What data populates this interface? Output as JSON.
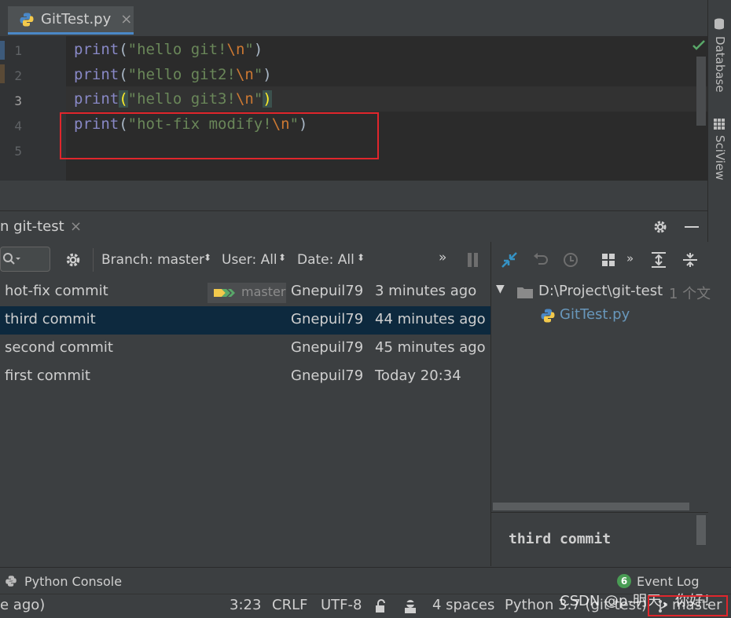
{
  "editor": {
    "tab_label": "GitTest.py",
    "close_glyph": "×",
    "line_numbers": [
      "1",
      "2",
      "3",
      "4",
      "5"
    ],
    "lines": [
      {
        "fn": "print",
        "open": "(",
        "str": "\"hello git!",
        "esc": "\\n",
        "strend": "\"",
        "close": ")"
      },
      {
        "fn": "print",
        "open": "(",
        "str": "\"hello git2!",
        "esc": "\\n",
        "strend": "\"",
        "close": ")"
      },
      {
        "fn": "print",
        "open": "(",
        "str": "\"hello git3!",
        "esc": "\\n",
        "strend": "\"",
        "close": ")"
      },
      {
        "fn": "print",
        "open": "(",
        "str": "\"hot-fix modify!",
        "esc": "\\n",
        "strend": "\"",
        "close": ")"
      }
    ]
  },
  "right_sidebar": {
    "database_label": "Database",
    "sciview_label": "SciView"
  },
  "git_panel": {
    "title": "n git-test",
    "close_glyph": "×",
    "branch_filter": "Branch: master",
    "user_filter": "User: All",
    "date_filter": "Date: All",
    "more_glyph": "»",
    "commits": [
      {
        "message": "hot-fix commit",
        "author": "Gnepuil79",
        "date": "3 minutes ago",
        "badge": "master"
      },
      {
        "message": "third commit",
        "author": "Gnepuil79",
        "date": "44 minutes ago"
      },
      {
        "message": "second commit",
        "author": "Gnepuil79",
        "date": "45 minutes ago"
      },
      {
        "message": "first commit",
        "author": "Gnepuil79",
        "date": "Today 20:34"
      }
    ],
    "tree_root": "D:\\Project\\git-test",
    "tree_root_suffix": "1 个文",
    "tree_file": "GitTest.py",
    "commit_message": "third commit"
  },
  "tool_windows": {
    "python_console": "Python Console",
    "event_log": "Event Log",
    "event_count": "6"
  },
  "status_bar": {
    "left_text": "e ago)",
    "position": "3:23",
    "line_sep": "CRLF",
    "encoding": "UTF-8",
    "indent": "4 spaces",
    "interpreter": "Python 3.7 (git-test)",
    "branch": "master",
    "watermark": "CSDN @p-明天，你好！"
  },
  "colors": {
    "accent": "#4a88c7",
    "highlight_box": "#e0262c",
    "selection": "#0d293e"
  }
}
